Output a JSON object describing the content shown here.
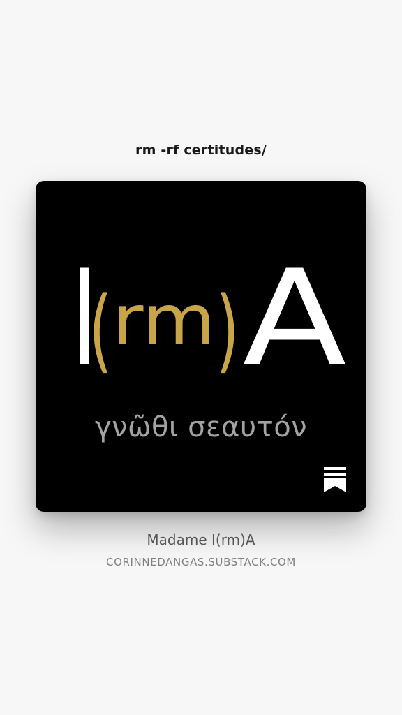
{
  "post": {
    "title": "rm -rf certitudes/"
  },
  "cover": {
    "logo_letters": [
      "I",
      "(",
      "rm",
      ")",
      "A"
    ],
    "motto": "γνῶθι σεαυτόν",
    "bookmark_icon": "substack-bookmark-icon",
    "colors": {
      "background": "#000000",
      "letter": "#ffffff",
      "accent": "#c9a54a",
      "motto": "#a3a3a3"
    }
  },
  "publication": {
    "name": "Madame I(rm)A",
    "url": "CORINNEDANGAS.SUBSTACK.COM"
  }
}
